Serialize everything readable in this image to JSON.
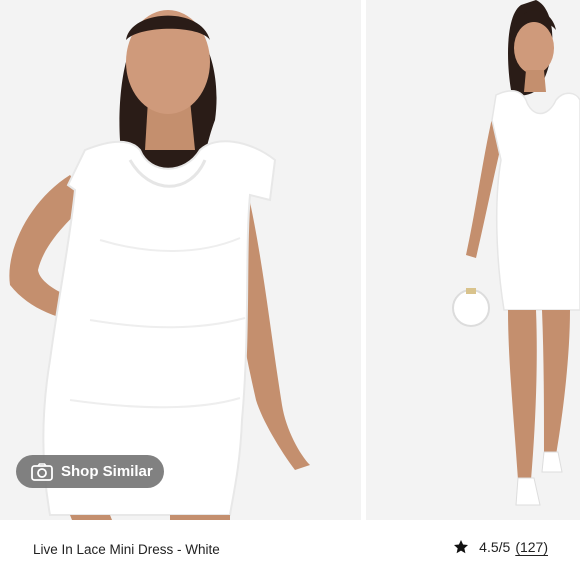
{
  "gallery": {
    "shop_similar_label": "Shop Similar",
    "camera_icon": "camera-icon",
    "images": [
      "front-view",
      "full-body-view"
    ]
  },
  "product": {
    "title": "Live In Lace Mini Dress - White",
    "rating": "4.5/5",
    "review_count": "(127)",
    "star_icon": "star-icon"
  },
  "colors": {
    "background": "#f4f4f4",
    "button_overlay": "#707070",
    "text": "#222222",
    "dress": "#ffffff",
    "skin": "#c99272",
    "hair": "#2a1c17"
  }
}
